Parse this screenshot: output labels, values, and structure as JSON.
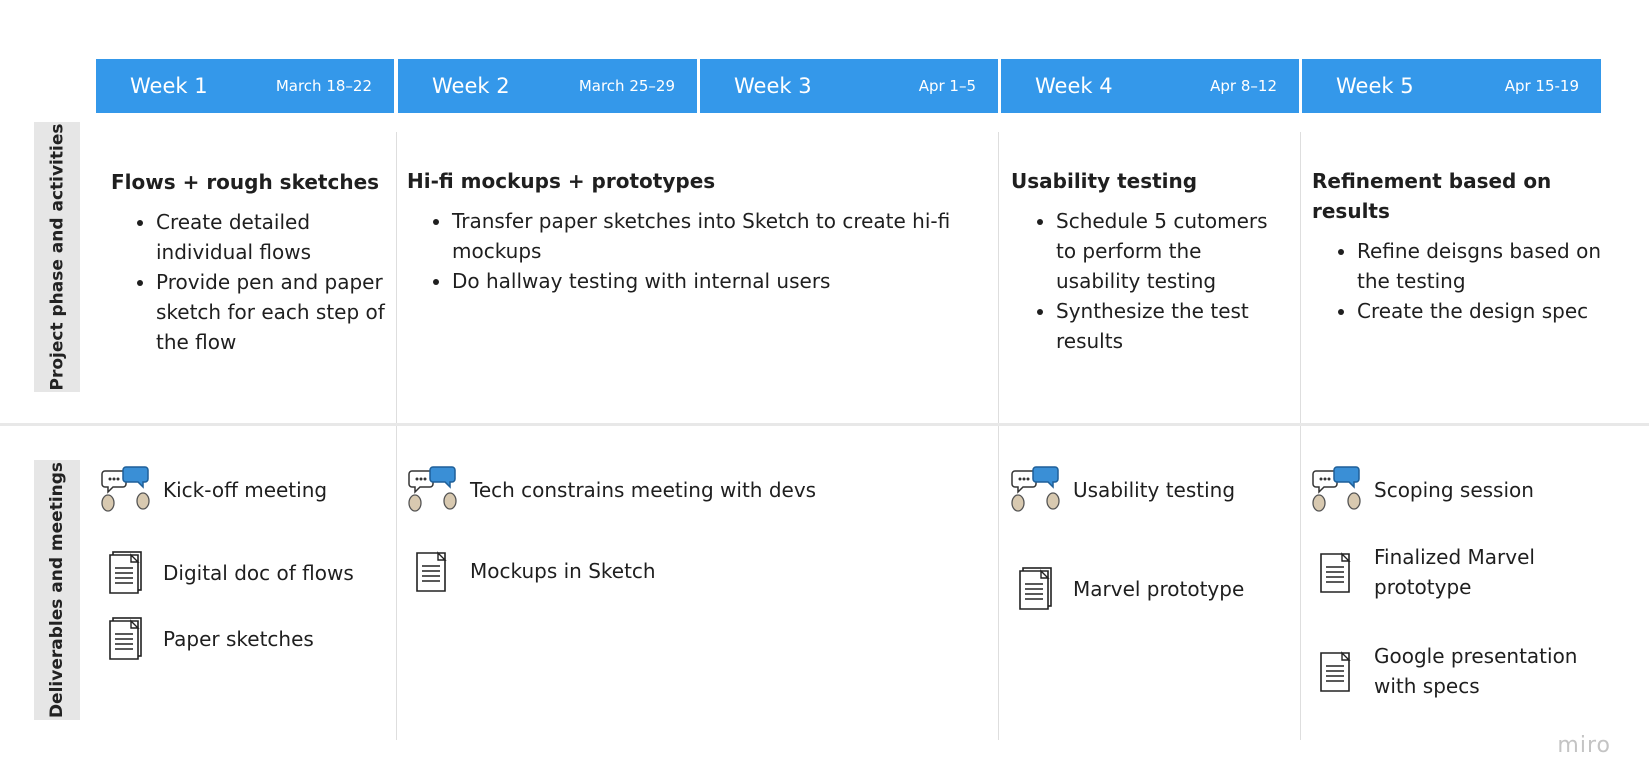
{
  "weeks": [
    {
      "name": "Week 1",
      "dates": "March 18–22"
    },
    {
      "name": "Week 2",
      "dates": "March 25–29"
    },
    {
      "name": "Week 3",
      "dates": "Apr 1–5"
    },
    {
      "name": "Week 4",
      "dates": "Apr 8–12"
    },
    {
      "name": "Week 5",
      "dates": "Apr 15-19"
    }
  ],
  "rows": {
    "phase_label": "Project phase and activities",
    "deliverables_label": "Deliverables and meetings"
  },
  "phases": [
    {
      "title": "Flows + rough sketches",
      "bullets": [
        "Create detailed individual flows",
        "Provide pen and paper sketch for each step of the flow"
      ]
    },
    {
      "title": "Hi-fi mockups + prototypes",
      "bullets": [
        "Transfer paper sketches into Sketch to create hi-fi mockups",
        "Do hallway testing with internal users"
      ]
    },
    {
      "title": "Usability testing",
      "bullets": [
        "Schedule 5 cutomers to perform the usability testing",
        "Synthesize the test results"
      ]
    },
    {
      "title": "Refinement based on results",
      "bullets": [
        "Refine deisgns based on the testing",
        "Create the design spec"
      ]
    }
  ],
  "deliverables": {
    "col1": [
      {
        "icon": "meeting-icon",
        "label": "Kick-off meeting"
      },
      {
        "icon": "document-icon",
        "label": "Digital doc of flows"
      },
      {
        "icon": "document-icon",
        "label": "Paper sketches"
      }
    ],
    "col2": [
      {
        "icon": "meeting-icon",
        "label": "Tech constrains meeting with devs"
      },
      {
        "icon": "document-icon",
        "label": "Mockups in Sketch"
      }
    ],
    "col3": [
      {
        "icon": "meeting-icon",
        "label": "Usability testing"
      },
      {
        "icon": "document-icon",
        "label": "Marvel prototype"
      }
    ],
    "col4": [
      {
        "icon": "meeting-icon",
        "label": "Scoping session"
      },
      {
        "icon": "document-icon",
        "label": "Finalized Marvel prototype"
      },
      {
        "icon": "document-icon",
        "label": "Google presentation with specs"
      }
    ]
  },
  "brand": "miro",
  "colors": {
    "header": "#3498ea",
    "row_label_bg": "#e6e6e6"
  }
}
